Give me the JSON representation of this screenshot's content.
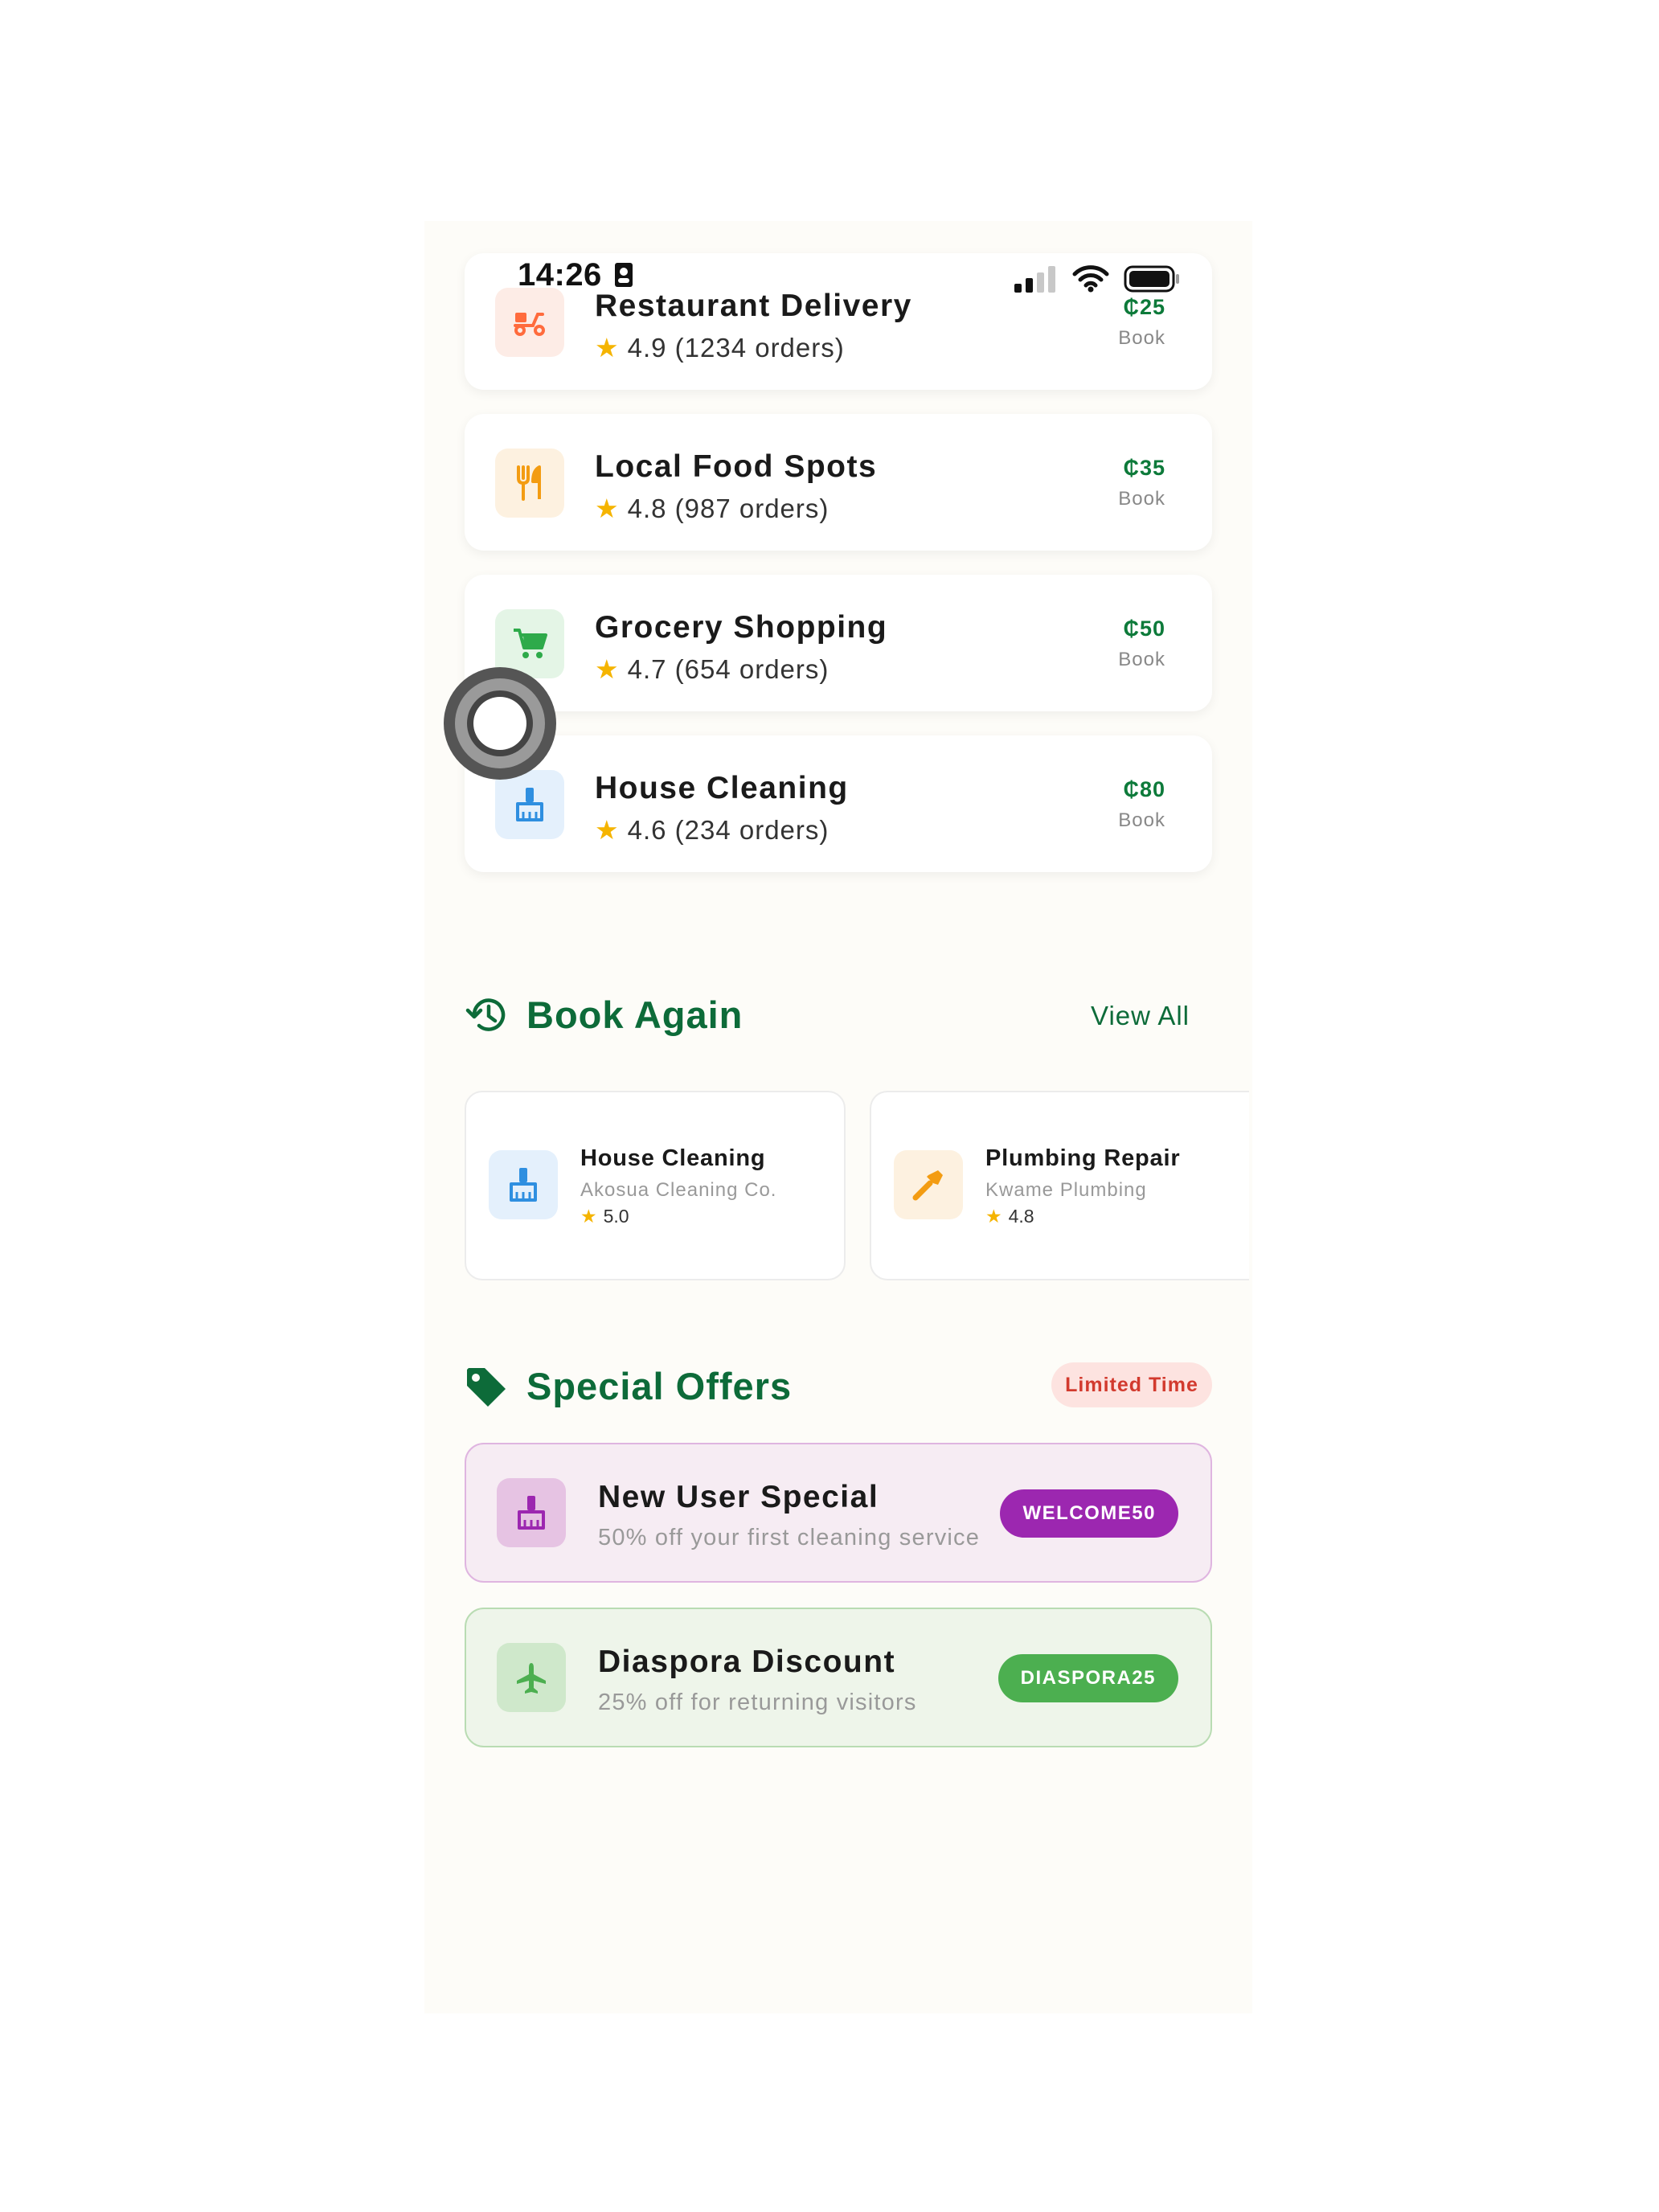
{
  "status_bar": {
    "time": "14:26"
  },
  "services": [
    {
      "title": "Restaurant Delivery",
      "rating": "4.9",
      "orders": "(1234 orders)",
      "price": "₵25",
      "action": "Book",
      "icon": "scooter-icon",
      "color": "#ff6b3d"
    },
    {
      "title": "Local Food Spots",
      "rating": "4.8",
      "orders": "(987 orders)",
      "price": "₵35",
      "action": "Book",
      "icon": "fork-knife-icon",
      "color": "#f39c12"
    },
    {
      "title": "Grocery Shopping",
      "rating": "4.7",
      "orders": "(654 orders)",
      "price": "₵50",
      "action": "Book",
      "icon": "cart-icon",
      "color": "#2eaa4a"
    },
    {
      "title": "House Cleaning",
      "rating": "4.6",
      "orders": "(234 orders)",
      "price": "₵80",
      "action": "Book",
      "icon": "broom-icon",
      "color": "#2f8fe0"
    }
  ],
  "book_again": {
    "title": "Book Again",
    "view_all": "View All",
    "items": [
      {
        "title": "House Cleaning",
        "provider": "Akosua Cleaning Co.",
        "rating": "5.0",
        "icon": "broom-icon"
      },
      {
        "title": "Plumbing Repair",
        "provider": "Kwame Plumbing",
        "rating": "4.8",
        "icon": "wrench-icon"
      }
    ]
  },
  "special_offers": {
    "title": "Special Offers",
    "badge": "Limited Time",
    "items": [
      {
        "title": "New User Special",
        "description": "50% off your first cleaning service",
        "code": "WELCOME50",
        "icon": "broom-icon",
        "accent": "#9c27b0"
      },
      {
        "title": "Diaspora Discount",
        "description": "25% off for returning visitors",
        "code": "DIASPORA25",
        "icon": "airplane-icon",
        "accent": "#4caf50"
      }
    ]
  },
  "colors": {
    "brand_green": "#0d6b39",
    "price_green": "#0d7a3a",
    "star": "#f5b400",
    "background": "#fdfcf8"
  }
}
